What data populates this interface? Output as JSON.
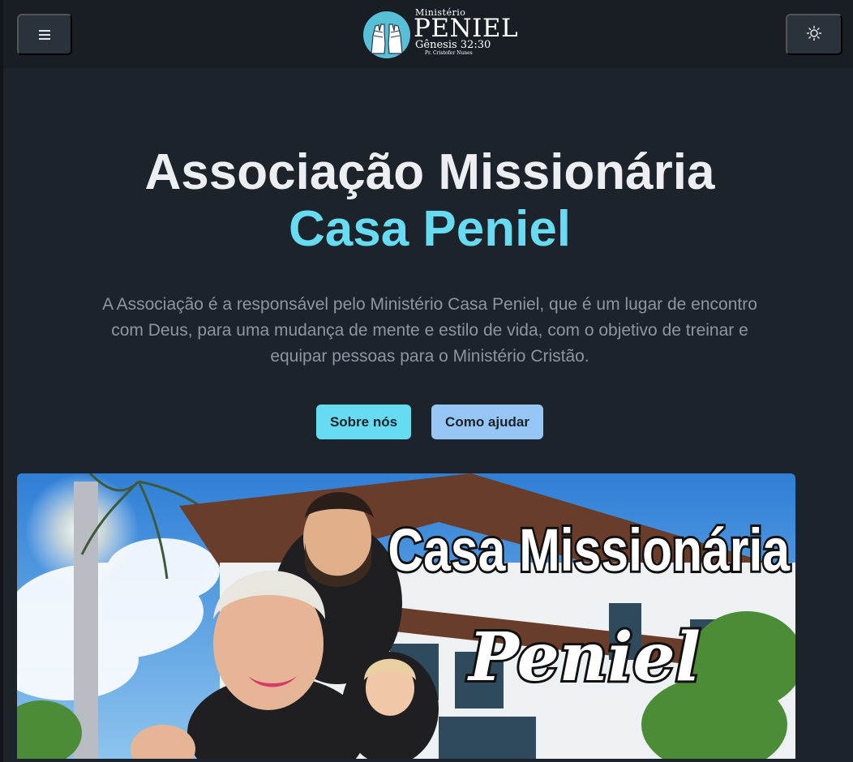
{
  "navbar": {
    "menu_icon": "hamburger-menu-icon",
    "theme_icon": "sun-icon",
    "logo": {
      "line1": "Ministério",
      "line2": "PENIEL",
      "line3": "Gênesis 32:30",
      "line4": "Pr. Cristofer Nunes"
    }
  },
  "hero": {
    "title": "Associação Missionária",
    "title_accent": "Casa Peniel",
    "description": "A Associação é a responsável pelo Ministério Casa Peniel, que é um lugar de encontro com Deus, para uma mudança de mente e estilo de vida, com o objetivo de treinar e equipar pessoas para o Ministério Cristão.",
    "buttons": {
      "about": "Sobre nós",
      "help": "Como ajudar"
    }
  },
  "banner": {
    "title_line1": "Casa Missionária",
    "title_line2": "Peniel"
  },
  "colors": {
    "background": "#1d232a",
    "navbar": "#191e24",
    "accent": "#66dbf1",
    "secondary": "#96c6f5",
    "muted_text": "#8c96a3"
  }
}
